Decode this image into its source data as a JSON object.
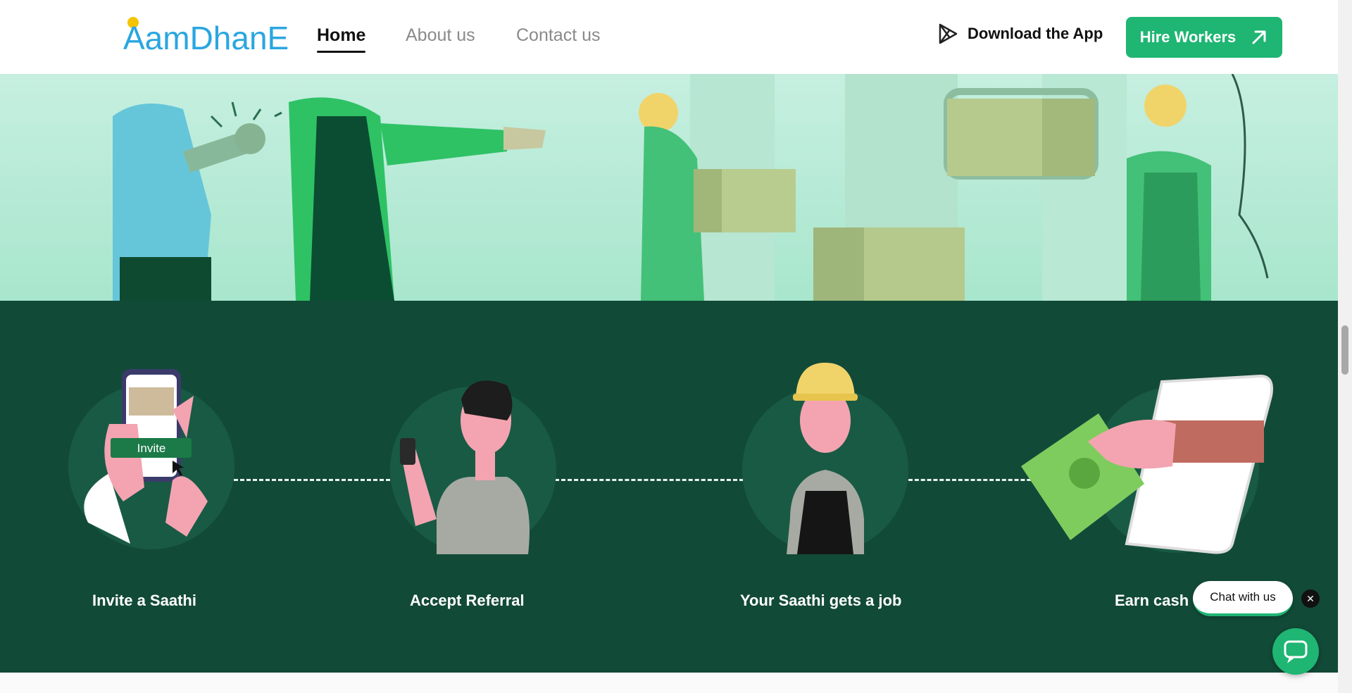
{
  "brand": {
    "logo_text": "AamDhanE",
    "accent": "#1fb573",
    "dark_green": "#124a38"
  },
  "nav": {
    "links": [
      {
        "label": "Home",
        "active": true
      },
      {
        "label": "About us",
        "active": false
      },
      {
        "label": "Contact us",
        "active": false
      }
    ],
    "download_label": "Download the App",
    "download_icon": "play-store-icon",
    "hire_label": "Hire Workers",
    "hire_icon": "arrow-up-right-icon"
  },
  "hero": {
    "illustration": "workers-handshake-warehouse"
  },
  "steps": [
    {
      "label": "Invite a Saathi",
      "illustration": "phone-invite",
      "button_text": "Invite"
    },
    {
      "label": "Accept Referral",
      "illustration": "man-with-phone"
    },
    {
      "label": "Your Saathi gets a job",
      "illustration": "worker-with-helmet"
    },
    {
      "label": "Earn cash",
      "illustration": "cash-from-phone"
    }
  ],
  "chat": {
    "bubble_label": "Chat with us",
    "close_icon": "close-icon",
    "button_icon": "chat-icon"
  }
}
